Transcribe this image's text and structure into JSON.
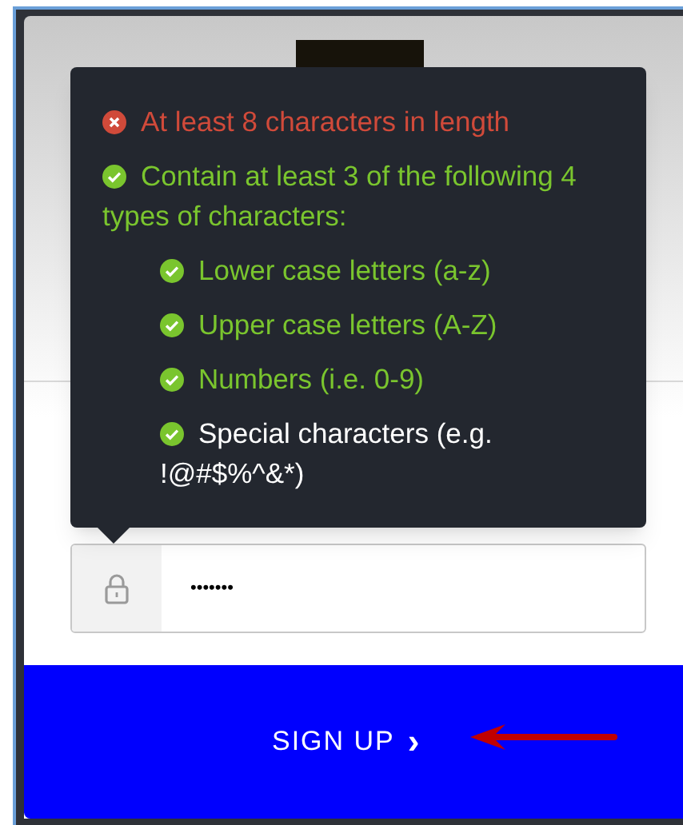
{
  "password_rules": [
    {
      "label": "At least 8 characters in length",
      "met": false,
      "color": "#d04a3a"
    },
    {
      "label": "Contain at least 3 of the following 4 types of characters:",
      "met": true,
      "color": "#7ac52e",
      "children": [
        {
          "label": "Lower case letters (a-z)",
          "met": true,
          "color": "#7ac52e"
        },
        {
          "label": "Upper case letters (A-Z)",
          "met": true,
          "color": "#7ac52e"
        },
        {
          "label": "Numbers (i.e. 0-9)",
          "met": true,
          "color": "#7ac52e"
        },
        {
          "label": "Special characters (e.g. !@#$%^&*)",
          "met": true,
          "color": "#ffffff"
        }
      ]
    }
  ],
  "password_field": {
    "value": "•••••••"
  },
  "sign_up_button": {
    "label": "SIGN UP",
    "chevron": "›"
  }
}
